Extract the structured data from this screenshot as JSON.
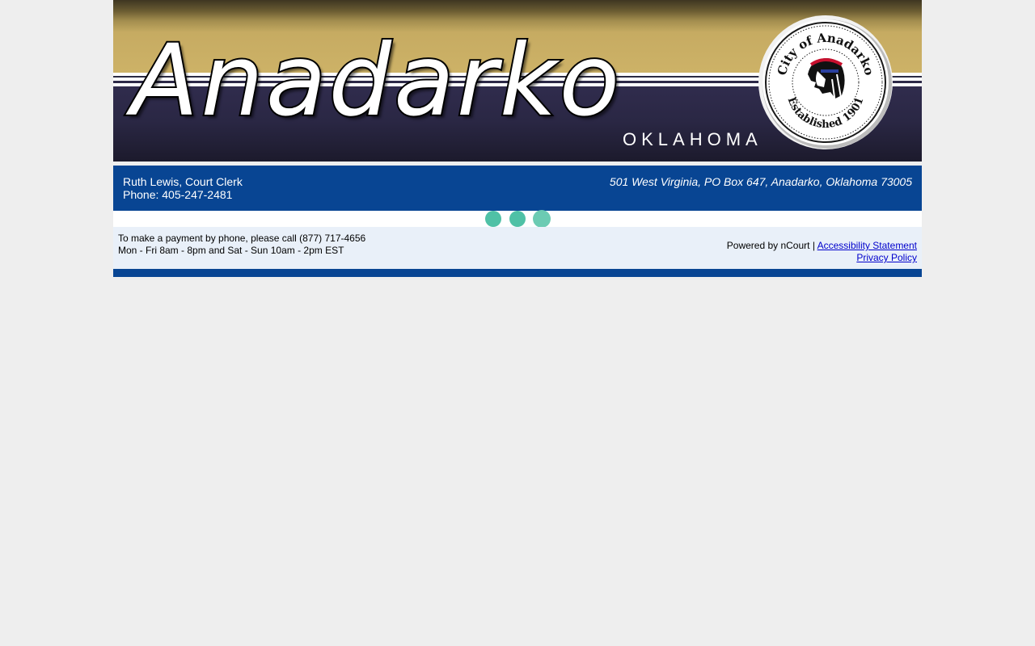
{
  "banner": {
    "title": "Anadarko",
    "state": "OKLAHOMA",
    "seal": {
      "top_text": "City of Anadarko",
      "bottom_text": "Established 1901"
    }
  },
  "court_info": {
    "clerk": "Ruth Lewis, Court Clerk",
    "phone": "Phone: 405-247-2481",
    "address": "501 West Virginia, PO Box 647, Anadarko, Oklahoma 73005"
  },
  "loader": {
    "icon": "loading-dots-icon",
    "color": "#4fc1a6"
  },
  "footer": {
    "payment_line1": "To make a payment by phone, please call (877) 717-4656",
    "payment_line2": "Mon - Fri 8am - 8pm and Sat - Sun 10am - 2pm EST",
    "powered_by": "Powered by nCourt | ",
    "accessibility_link": "Accessibility Statement",
    "privacy_link": "Privacy Policy"
  },
  "colors": {
    "page_background": "#eeeeee",
    "brand_blue": "#084593",
    "banner_gold": "#cdb267",
    "banner_navy": "#2d2a48",
    "footer_background": "#e9f0f9",
    "link": "#0000cc"
  }
}
